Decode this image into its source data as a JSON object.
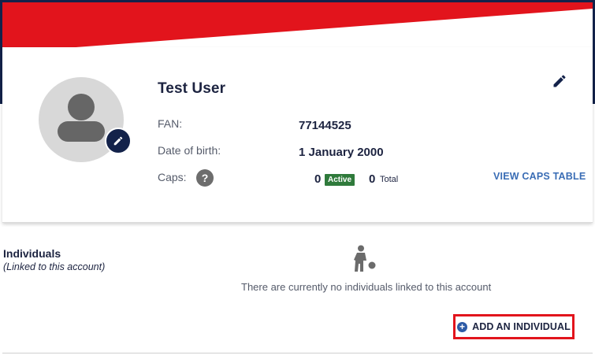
{
  "colors": {
    "navy": "#13224a",
    "banner_red": "#e2141c",
    "link_blue": "#3a6db5",
    "active_green": "#2f7a3b",
    "highlight_red": "#e2141c"
  },
  "profile": {
    "name": "Test User",
    "fan_label": "FAN:",
    "fan_value": "77144525",
    "dob_label": "Date of birth:",
    "dob_value": "1 January 2000",
    "caps_label": "Caps:",
    "caps_help_icon": "?",
    "caps_active_count": "0",
    "caps_active_badge": "Active",
    "caps_total_count": "0",
    "caps_total_label": "Total",
    "view_caps_link": "VIEW CAPS TABLE",
    "icons": {
      "avatar": "person-avatar-icon",
      "avatar_edit": "pencil-icon",
      "profile_edit": "pencil-icon"
    }
  },
  "individuals": {
    "title": "Individuals",
    "subtitle": "(Linked to this account)",
    "empty_icon": "football-player-icon",
    "empty_message": "There are currently no individuals linked to this account",
    "add_button_label": "ADD AN INDIVIDUAL",
    "add_button_icon": "+"
  }
}
